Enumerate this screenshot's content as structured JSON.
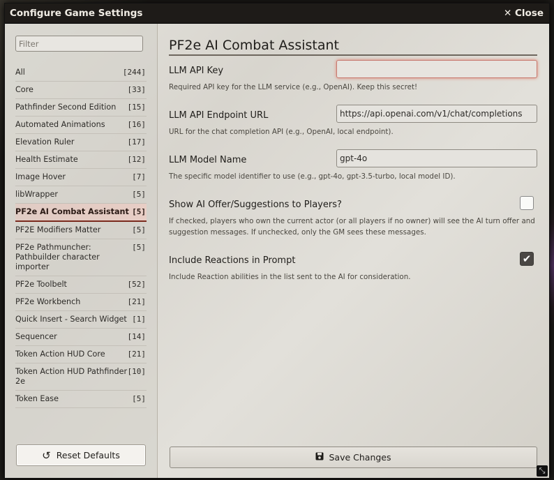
{
  "window": {
    "title": "Configure Game Settings",
    "close_label": "Close",
    "close_icon": "times-icon"
  },
  "sidebar": {
    "filter_placeholder": "Filter",
    "items": [
      {
        "label": "All",
        "count": "[244]"
      },
      {
        "label": "Core",
        "count": "[33]"
      },
      {
        "label": "Pathfinder Second Edition",
        "count": "[15]"
      },
      {
        "label": "Automated Animations",
        "count": "[16]"
      },
      {
        "label": "Elevation Ruler",
        "count": "[17]"
      },
      {
        "label": "Health Estimate",
        "count": "[12]"
      },
      {
        "label": "Image Hover",
        "count": "[7]"
      },
      {
        "label": "libWrapper",
        "count": "[5]"
      },
      {
        "label": "PF2e AI Combat Assistant",
        "count": "[5]",
        "active": true
      },
      {
        "label": "PF2E Modifiers Matter",
        "count": "[5]"
      },
      {
        "label": "PF2e Pathmuncher: Pathbuilder character importer",
        "count": "[5]"
      },
      {
        "label": "PF2e Toolbelt",
        "count": "[52]"
      },
      {
        "label": "PF2e Workbench",
        "count": "[21]"
      },
      {
        "label": "Quick Insert - Search Widget",
        "count": "[1]"
      },
      {
        "label": "Sequencer",
        "count": "[14]"
      },
      {
        "label": "Token Action HUD Core",
        "count": "[21]"
      },
      {
        "label": "Token Action HUD Pathfinder 2e",
        "count": "[10]"
      },
      {
        "label": "Token Ease",
        "count": "[5]"
      }
    ],
    "reset_label": "Reset Defaults",
    "reset_icon": "undo-icon"
  },
  "main": {
    "heading": "PF2e AI Combat Assistant",
    "api_key": {
      "label": "LLM API Key",
      "value": "",
      "hint": "Required API key for the LLM service (e.g., OpenAI). Keep this secret!"
    },
    "endpoint": {
      "label": "LLM API Endpoint URL",
      "value": "https://api.openai.com/v1/chat/completions",
      "hint": "URL for the chat completion API (e.g., OpenAI, local endpoint)."
    },
    "model": {
      "label": "LLM Model Name",
      "value": "gpt-4o",
      "hint": "The specific model identifier to use (e.g., gpt-4o, gpt-3.5-turbo, local model ID)."
    },
    "show_offer": {
      "label": "Show AI Offer/Suggestions to Players?",
      "checked": false,
      "hint": "If checked, players who own the current actor (or all players if no owner) will see the AI turn offer and suggestion messages. If unchecked, only the GM sees these messages."
    },
    "include_reactions": {
      "label": "Include Reactions in Prompt",
      "checked": true,
      "hint": "Include Reaction abilities in the list sent to the AI for consideration."
    },
    "save_label": "Save Changes",
    "save_icon": "floppy-disk-icon"
  },
  "colors": {
    "titlebar": "#1e1b18",
    "active_accent": "#7a2a1e",
    "focus_glow": "#e08070"
  }
}
